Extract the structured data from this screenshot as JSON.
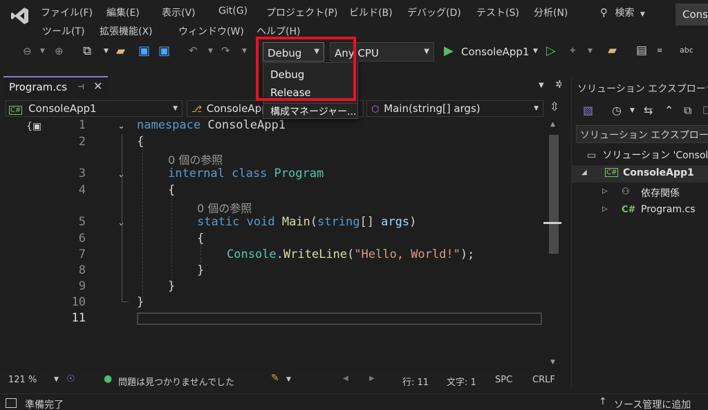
{
  "menu": {
    "row1": [
      "ファイル(F)",
      "編集(E)",
      "表示(V)",
      "Git(G)",
      "プロジェクト(P)",
      "ビルド(B)",
      "デバッグ(D)",
      "テスト(S)",
      "分析(N)"
    ],
    "row2": [
      "ツール(T)",
      "拡張機能(X)",
      "ウィンドウ(W)",
      "ヘルプ(H)"
    ],
    "search": "検索",
    "title_tab": "Conso"
  },
  "toolbar": {
    "config_value": "Debug",
    "platform_value": "Any CPU",
    "run_target": "ConsoleApp1"
  },
  "config_dropdown": {
    "options": [
      "Debug",
      "Release"
    ],
    "manager": "構成マネージャー..."
  },
  "editor": {
    "tab_name": "Program.cs",
    "nav_project": "ConsoleApp1",
    "nav_class": "ConsoleApp",
    "nav_member": "Main(string[] args)",
    "line_numbers": [
      "1",
      "2",
      "3",
      "4",
      "5",
      "6",
      "7",
      "8",
      "9",
      "10",
      "11"
    ],
    "code": {
      "l1_kw": "namespace",
      "l1_name": " ConsoleApp1",
      "l2": "{",
      "ref1": "0 個の参照",
      "l3_kw": "internal class",
      "l3_ty": " Program",
      "l4": "{",
      "ref2": "0 個の参照",
      "l5_kw": "static void",
      "l5_fn": " Main",
      "l5_p1": "(",
      "l5_kw2": "string",
      "l5_p2": "[] ",
      "l5_arg": "args",
      "l5_p3": ")",
      "l6": "{",
      "l7_ty": "Console",
      "l7_dot": ".",
      "l7_fn": "WriteLine",
      "l7_p1": "(",
      "l7_str": "\"Hello, World!\"",
      "l7_p2": ");",
      "l8": "}",
      "l9": "}",
      "l10": "}"
    }
  },
  "solution_explorer": {
    "title": "ソリューション エクスプローラー",
    "search_placeholder": "ソリューション エクスプローラー -",
    "solution": "ソリューション 'Console",
    "project": "ConsoleApp1",
    "dependencies": "依存関係",
    "file": "Program.cs",
    "cs_badge": "C#"
  },
  "statusbar": {
    "zoom": "121 %",
    "issues": "問題は見つかりませんでした",
    "line": "行: 11",
    "char": "文字: 1",
    "spc": "SPC",
    "crlf": "CRLF",
    "ready": "準備完了",
    "source_control": "ソース管理に追加"
  },
  "colors": {
    "highlight_box": "#e81123",
    "accent": "#8f7bd4",
    "run_green": "#4fc160"
  }
}
